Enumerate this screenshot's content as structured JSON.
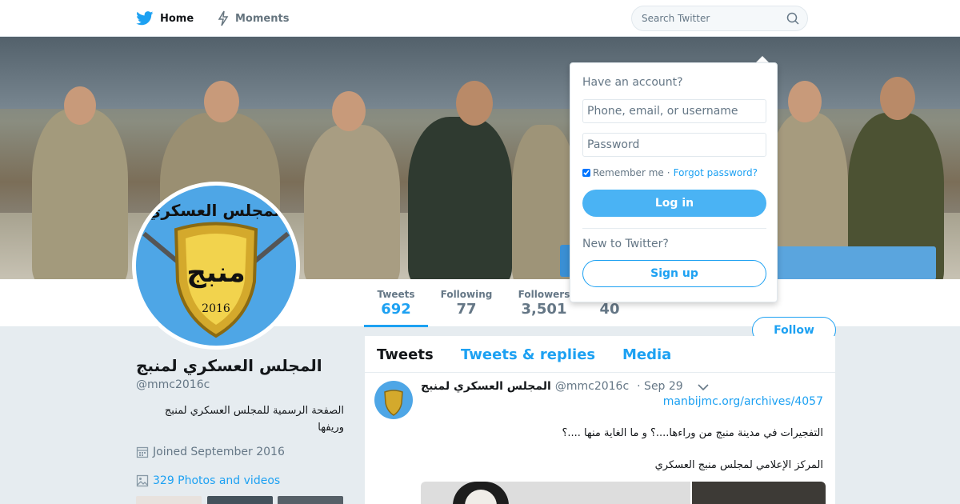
{
  "nav": {
    "home_label": "Home",
    "moments_label": "Moments",
    "search_placeholder": "Search Twitter"
  },
  "profile": {
    "name": "المجلس العسكري لمنبج",
    "handle": "@mmc2016c",
    "bio": "الصفحة الرسمية للمجلس العسكري لمنبج وريفها",
    "joined": "Joined September 2016",
    "photos": "329 Photos and videos",
    "avatar_text_top": "المجلس العسكري",
    "avatar_text_mid": "منبج",
    "avatar_year": "2016"
  },
  "stats": [
    {
      "label": "Tweets",
      "value": "692"
    },
    {
      "label": "Following",
      "value": "77"
    },
    {
      "label": "Followers",
      "value": "3,501"
    },
    {
      "label": "",
      "value": "40"
    }
  ],
  "follow_label": "Follow",
  "timeline": {
    "tabs": [
      "Tweets",
      "Tweets & replies",
      "Media"
    ],
    "tweet": {
      "name": "المجلس العسكري لمنبج",
      "handle": "@mmc2016c",
      "date": "· Sep 29",
      "link": "manbijmc.org/archives/4057",
      "line1": "التفجيرات في مدينة منبج من وراءها....؟ و ما الغاية منها ....؟",
      "line2": "المركز الإعلامي لمجلس منبج العسكري"
    }
  },
  "login": {
    "have_account": "Have an account?",
    "username_placeholder": "Phone, email, or username",
    "password_placeholder": "Password",
    "remember": "Remember me",
    "separator": "·",
    "forgot": "Forgot password?",
    "login_button": "Log in",
    "new_to": "New to Twitter?",
    "signup_button": "Sign up"
  },
  "colors": {
    "accent": "#1da1f2",
    "login_button": "#4ab3f4",
    "background": "#e6ecf0"
  },
  "icons": [
    "twitter-bird-icon",
    "moments-bolt-icon",
    "search-icon",
    "calendar-icon",
    "photo-icon",
    "chevron-down-icon"
  ]
}
